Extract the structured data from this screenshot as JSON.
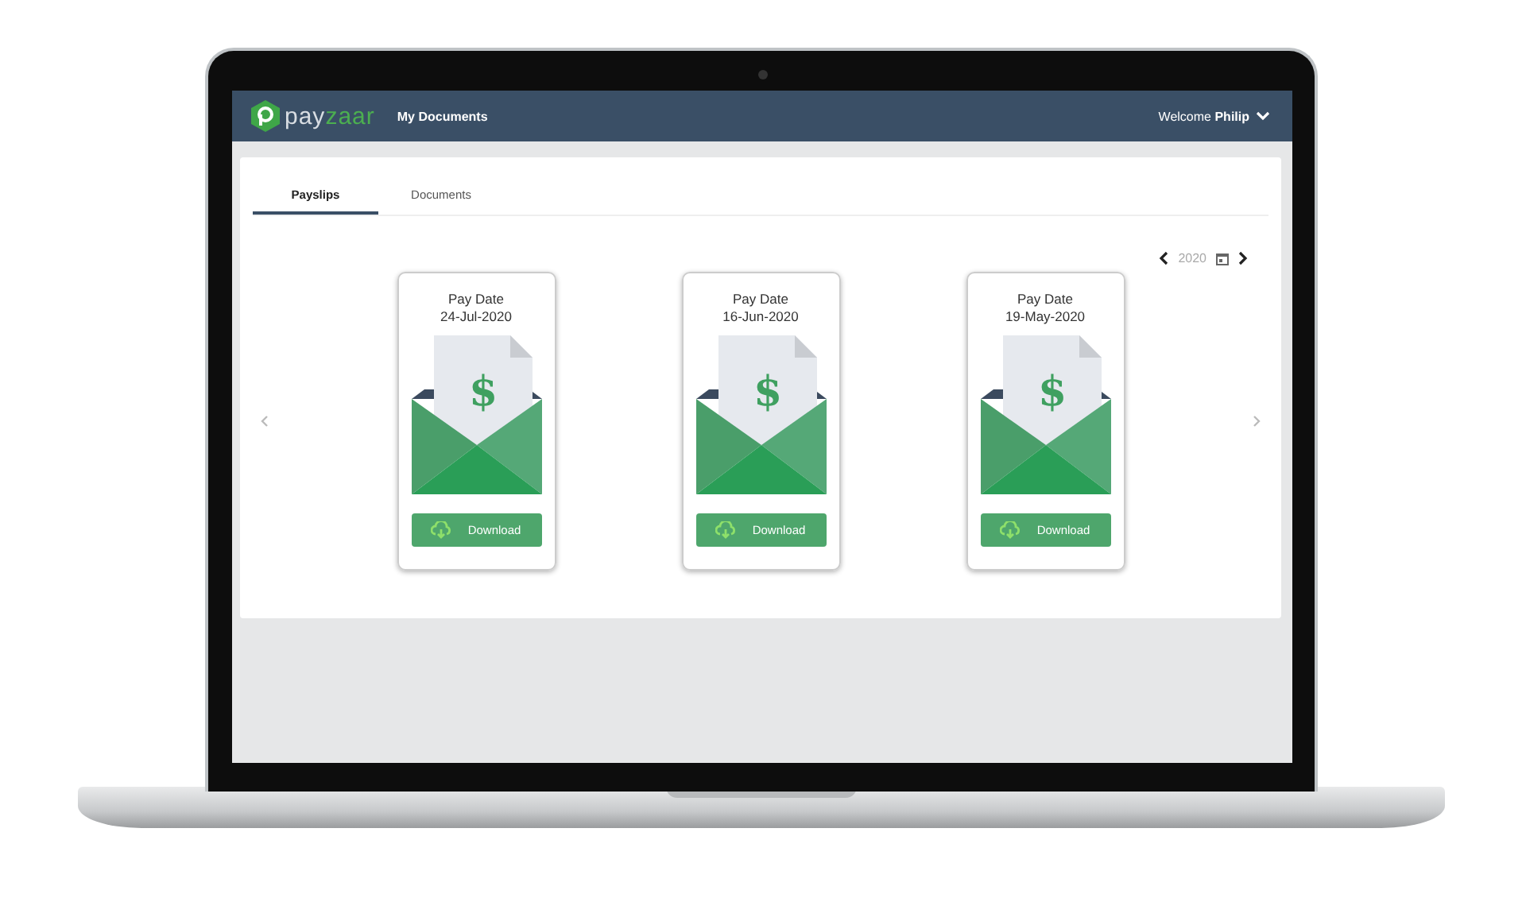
{
  "navbar": {
    "logo": {
      "first": "pay",
      "second": "zaar"
    },
    "menu": "My Documents",
    "user": "Welcome **Philip**"
  },
  "tabs": [
    {
      "label": "Payslips",
      "selected": true
    },
    {
      "label": "Documents",
      "selected": false
    }
  ],
  "year": "2020",
  "payslips": [
    {
      "label": "Pay Date",
      "date": "24-Jul-2020",
      "symbol": "$",
      "button": "Download"
    },
    {
      "label": "Pay Date",
      "date": "16-Jun-2020",
      "symbol": "$",
      "button": "Download"
    },
    {
      "label": "Pay Date",
      "date": "19-May-2020",
      "symbol": "$",
      "button": "Download"
    }
  ]
}
